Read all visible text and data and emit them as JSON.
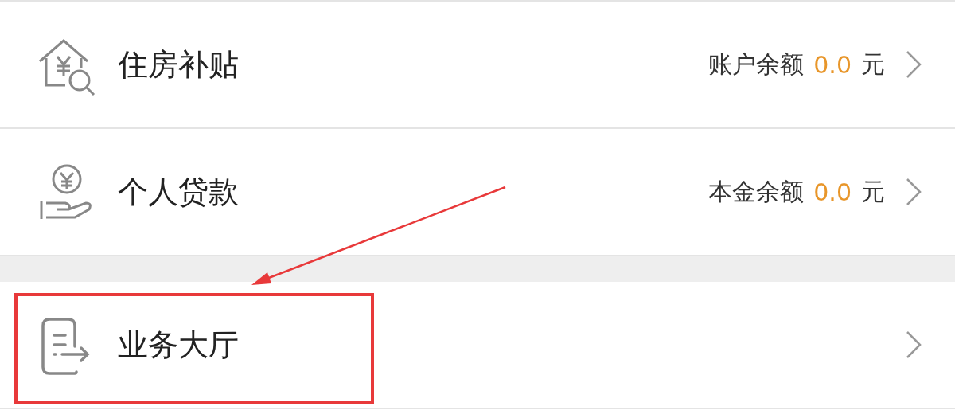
{
  "groups": [
    {
      "rows": [
        {
          "kind": "house",
          "label": "住房补贴",
          "summary": {
            "label": "账户余额",
            "amount": "0.0",
            "unit": "元"
          }
        },
        {
          "kind": "hand",
          "label": "个人贷款",
          "summary": {
            "label": "本金余额",
            "amount": "0.0",
            "unit": "元"
          }
        }
      ]
    },
    {
      "rows": [
        {
          "kind": "document",
          "label": "业务大厅"
        }
      ]
    }
  ],
  "annotation_arrow": {
    "color": "#e8393a"
  },
  "highlight_frame": {
    "color": "#e8393a"
  }
}
